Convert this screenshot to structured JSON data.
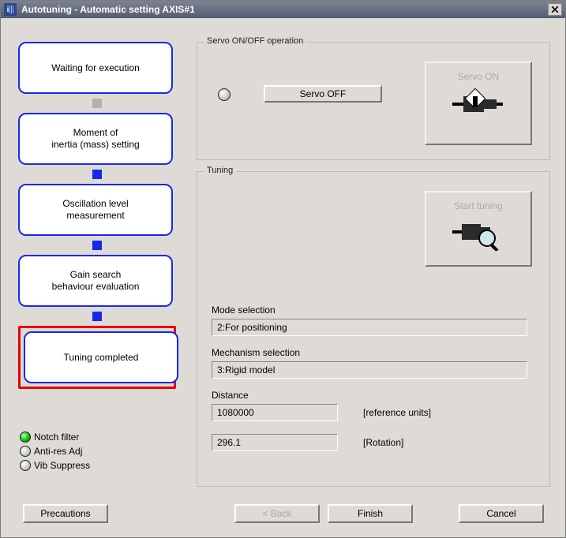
{
  "window": {
    "title": "Autotuning - Automatic setting AXIS#1"
  },
  "steps": [
    {
      "label": "Waiting for execution"
    },
    {
      "label": "Moment of\ninertia (mass) setting"
    },
    {
      "label": "Oscillation level\nmeasurement"
    },
    {
      "label": "Gain search\nbehaviour evaluation"
    },
    {
      "label": "Tuning completed"
    }
  ],
  "status": {
    "notch_filter": "Notch filter",
    "anti_res": "Anti-res Adj",
    "vib_suppress": "Vib Suppress"
  },
  "servo_group": {
    "legend": "Servo ON/OFF operation",
    "off_label": "Servo OFF",
    "on_label": "Servo ON"
  },
  "tuning_group": {
    "legend": "Tuning",
    "start_label": "Start tuning",
    "mode_label": "Mode selection",
    "mode_value": "2:For positioning",
    "mech_label": "Mechanism selection",
    "mech_value": "3:Rigid model",
    "distance_label": "Distance",
    "distance_value": "1080000",
    "distance_unit": "[reference units]",
    "rotation_value": "296.1",
    "rotation_unit": "[Rotation]"
  },
  "buttons": {
    "precautions": "Precautions",
    "back": "< Back",
    "finish": "Finish",
    "cancel": "Cancel"
  }
}
